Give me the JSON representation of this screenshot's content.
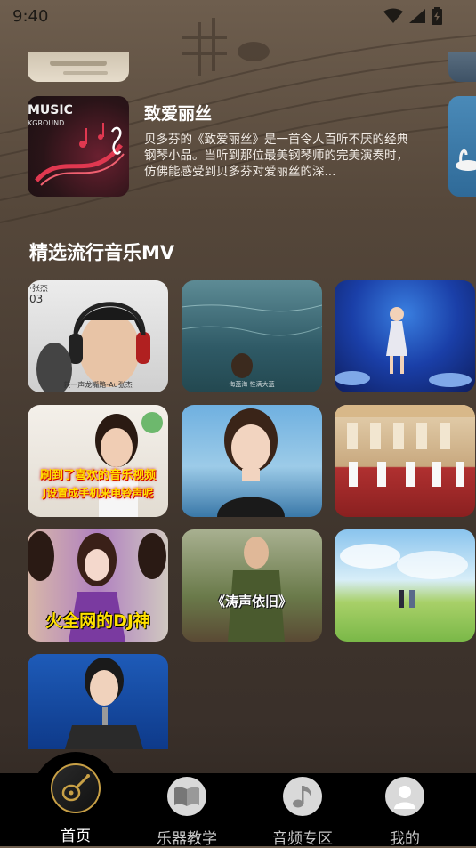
{
  "status_bar": {
    "time": "9:40"
  },
  "featured_article": {
    "title": "致爱丽丝",
    "description": "贝多芬的《致爱丽丝》是一首令人百听不厌的经典钢琴小品。当听到那位最美钢琴师的完美演奏时，仿佛能感受到贝多芬对爱丽丝的深...",
    "thumb_text_line1": "MUSIC",
    "thumb_text_line2": "KGROUND"
  },
  "mv_section": {
    "title": "精选流行音乐MV",
    "items": [
      {
        "caption_top": "·张杰",
        "caption_top2": "03",
        "caption_bottom": "获一声龙嘴路-Au张杰"
      },
      {
        "caption_bottom": "海蓝海 性满大蓝"
      },
      {
        "caption_bottom": ""
      },
      {
        "caption_line1": "刷到了喜欢的音乐视频",
        "caption_line2": "J设置成手机来电铃声呢"
      },
      {
        "caption_bottom": ""
      },
      {
        "caption_bottom": ""
      },
      {
        "caption_line1": "火全网的DJ神"
      },
      {
        "caption_line1": "《涛声依旧》"
      },
      {
        "caption_bottom": ""
      },
      {
        "caption_bottom": ""
      }
    ]
  },
  "tabs": [
    {
      "label": "首页",
      "icon": "guitar-icon",
      "active": true
    },
    {
      "label": "乐器教学",
      "icon": "book-icon",
      "active": false
    },
    {
      "label": "音频专区",
      "icon": "music-note-icon",
      "active": false
    },
    {
      "label": "我的",
      "icon": "user-icon",
      "active": false
    }
  ],
  "colors": {
    "accent": "#c8a046",
    "tabbar": "#000000"
  }
}
